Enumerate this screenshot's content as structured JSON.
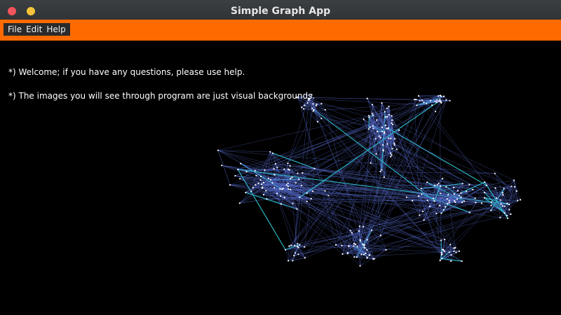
{
  "window": {
    "title": "Simple Graph App",
    "controls": [
      "close",
      "minimize"
    ]
  },
  "menubar": {
    "accent_color": "#ff6a00",
    "items": [
      {
        "label": "File"
      },
      {
        "label": "Edit"
      },
      {
        "label": "Help"
      }
    ]
  },
  "content": {
    "messages": [
      "*) Welcome; if you have any questions, please use help.",
      "*) The images you will see through program are just visual backgrounds."
    ],
    "background": {
      "description_icon": "network-graph-icon",
      "edge_color": "#5a6fd6",
      "highlight_edge_color": "#2ec9d6",
      "node_color": "#ffffff"
    }
  }
}
